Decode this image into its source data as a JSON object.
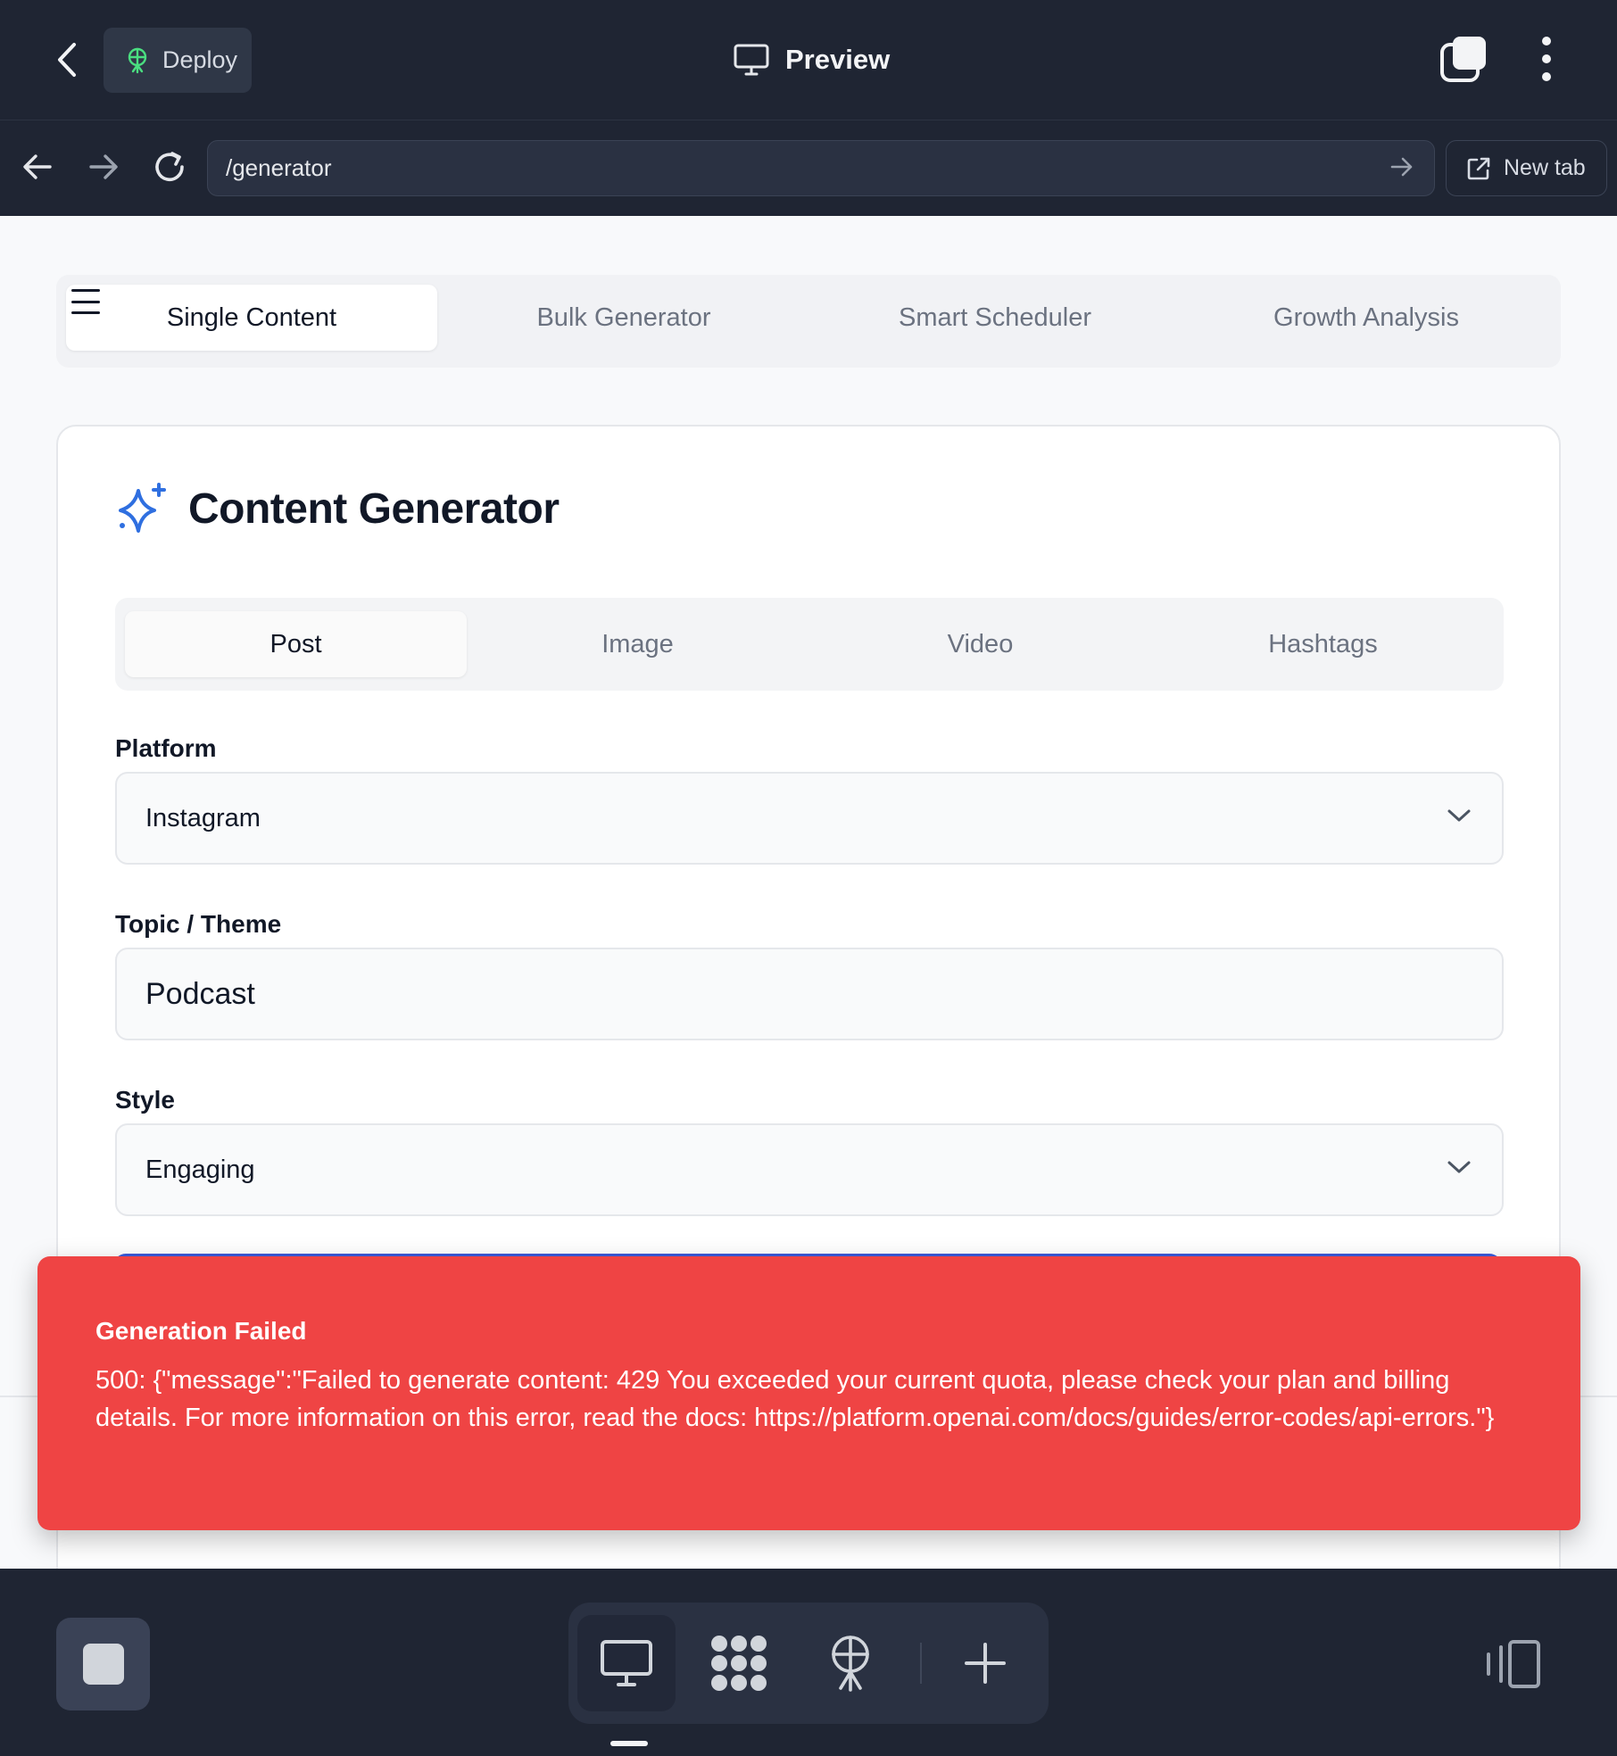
{
  "topbar": {
    "deploy_label": "Deploy",
    "preview_title": "Preview"
  },
  "urlbar": {
    "url": "/generator",
    "new_tab_label": "New tab"
  },
  "main_tabs": [
    {
      "label": "Single Content",
      "active": true
    },
    {
      "label": "Bulk Generator",
      "active": false
    },
    {
      "label": "Smart Scheduler",
      "active": false
    },
    {
      "label": "Growth Analysis",
      "active": false
    }
  ],
  "card": {
    "title": "Content Generator",
    "sub_tabs": [
      {
        "label": "Post",
        "active": true
      },
      {
        "label": "Image",
        "active": false
      },
      {
        "label": "Video",
        "active": false
      },
      {
        "label": "Hashtags",
        "active": false
      }
    ],
    "fields": {
      "platform": {
        "label": "Platform",
        "value": "Instagram"
      },
      "topic": {
        "label": "Topic / Theme",
        "value": "Podcast"
      },
      "style": {
        "label": "Style",
        "value": "Engaging"
      }
    }
  },
  "toast": {
    "title": "Generation Failed",
    "message": "500: {\"message\":\"Failed to generate content: 429 You exceeded your current quota, please check your plan and billing details. For more information on this error, read the docs: https://platform.openai.com/docs/guides/error-codes/api-errors.\"}"
  },
  "colors": {
    "chrome_bg": "#1f2533",
    "accent_blue": "#2f6fe0",
    "error_red": "#ef4444",
    "deploy_icon_green": "#4ade80"
  },
  "icons": [
    "back-chevron-icon",
    "deploy-tower-icon",
    "monitor-icon",
    "tabs-icon",
    "more-vertical-icon",
    "arrow-left-icon",
    "arrow-right-icon",
    "reload-icon",
    "arrow-go-icon",
    "external-link-icon",
    "hamburger-icon",
    "sparkles-icon",
    "chevron-down-icon",
    "stop-icon",
    "desktop-icon",
    "apps-grid-icon",
    "broadcast-icon",
    "plus-icon",
    "side-panel-icon"
  ]
}
